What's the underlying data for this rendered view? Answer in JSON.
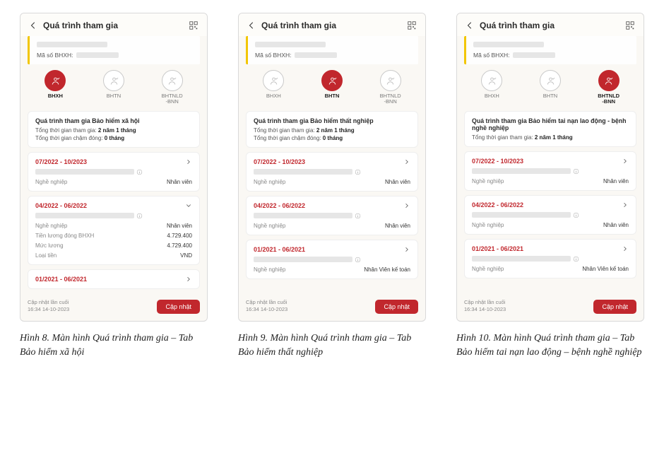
{
  "header": {
    "title": "Quá trình tham gia"
  },
  "user": {
    "code_label": "Mã số BHXH:"
  },
  "tabs": {
    "bhxh": "BHXH",
    "bhtn": "BHTN",
    "bhtnld": "BHTNLD\n-BNN"
  },
  "screens": [
    {
      "active_tab": 0,
      "summary": {
        "title": "Quá trình tham gia Bảo hiểm xã hội",
        "line1_label": "Tổng thời gian tham gia:",
        "line1_value": "2 năm 1 tháng",
        "line2_label": "Tổng thời gian chậm đóng:",
        "line2_value": "0 tháng"
      },
      "periods": [
        {
          "range": "07/2022 - 10/2023",
          "expanded": false,
          "rows": [
            {
              "k": "Nghề nghiệp",
              "v": "Nhân viên"
            }
          ]
        },
        {
          "range": "04/2022 - 06/2022",
          "expanded": true,
          "rows": [
            {
              "k": "Nghề nghiệp",
              "v": "Nhân viên"
            },
            {
              "k": "Tiền lương đóng BHXH",
              "v": "4.729.400"
            },
            {
              "k": "Mức lương",
              "v": "4.729.400"
            },
            {
              "k": "Loại tiền",
              "v": "VND"
            }
          ]
        },
        {
          "range": "01/2021 - 06/2021",
          "expanded": false,
          "collapsed_only": true
        }
      ]
    },
    {
      "active_tab": 1,
      "summary": {
        "title": "Quá trình tham gia Bảo hiểm thất nghiệp",
        "line1_label": "Tổng thời gian tham gia:",
        "line1_value": "2 năm 1 tháng",
        "line2_label": "Tổng thời gian chậm đóng:",
        "line2_value": "0 tháng"
      },
      "periods": [
        {
          "range": "07/2022 - 10/2023",
          "expanded": false,
          "rows": [
            {
              "k": "Nghề nghiệp",
              "v": "Nhân viên"
            }
          ]
        },
        {
          "range": "04/2022 - 06/2022",
          "expanded": false,
          "rows": [
            {
              "k": "Nghề nghiệp",
              "v": "Nhân viên"
            }
          ]
        },
        {
          "range": "01/2021 - 06/2021",
          "expanded": false,
          "rows": [
            {
              "k": "Nghề nghiệp",
              "v": "Nhân Viên kế toán"
            }
          ]
        }
      ]
    },
    {
      "active_tab": 2,
      "summary": {
        "title": "Quá trình tham gia Bảo hiểm tai nạn lao động - bệnh nghề nghiệp",
        "line1_label": "Tổng thời gian tham gia:",
        "line1_value": "2 năm 1 tháng"
      },
      "periods": [
        {
          "range": "07/2022 - 10/2023",
          "expanded": false,
          "rows": [
            {
              "k": "Nghề nghiệp",
              "v": "Nhân viên"
            }
          ]
        },
        {
          "range": "04/2022 - 06/2022",
          "expanded": false,
          "rows": [
            {
              "k": "Nghề nghiệp",
              "v": "Nhân viên"
            }
          ]
        },
        {
          "range": "01/2021 - 06/2021",
          "expanded": false,
          "rows": [
            {
              "k": "Nghề nghiệp",
              "v": "Nhân Viên kế toán"
            }
          ]
        }
      ]
    }
  ],
  "footer": {
    "last_update_label": "Cập nhật lần cuối",
    "last_update_value": "16:34 14-10-2023",
    "update_btn": "Cập nhật"
  },
  "captions": [
    "Hình 8. Màn hình Quá trình tham gia – Tab Bảo hiểm xã hội",
    "Hình 9. Màn hình Quá trình tham gia – Tab Bảo hiểm thất nghiệp",
    "Hình 10. Màn hình Quá trình tham gia – Tab Bảo hiểm tai nạn lao động – bệnh nghề nghiệp"
  ]
}
